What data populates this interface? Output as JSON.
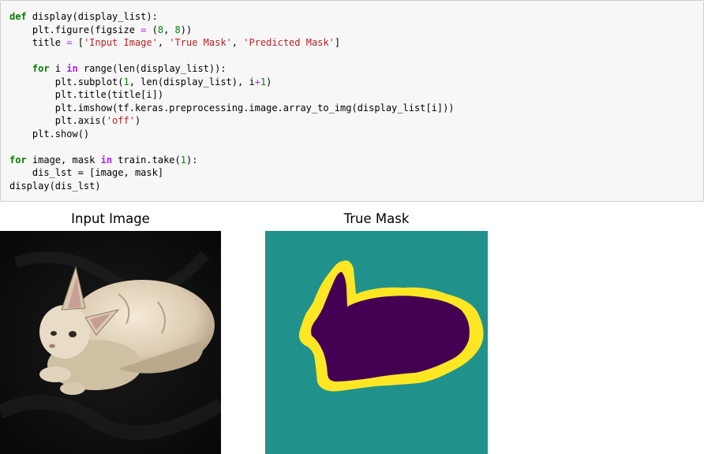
{
  "code_lines": [
    [
      {
        "t": "def",
        "c": "kw"
      },
      {
        "t": " display(display_list):"
      }
    ],
    [
      {
        "t": "    plt.figure(figsize "
      },
      {
        "t": "=",
        "c": "op"
      },
      {
        "t": " ("
      },
      {
        "t": "8",
        "c": "num"
      },
      {
        "t": ", "
      },
      {
        "t": "8",
        "c": "num"
      },
      {
        "t": "))"
      }
    ],
    [
      {
        "t": "    title "
      },
      {
        "t": "=",
        "c": "op"
      },
      {
        "t": " ["
      },
      {
        "t": "'Input Image'",
        "c": "str"
      },
      {
        "t": ", "
      },
      {
        "t": "'True Mask'",
        "c": "str"
      },
      {
        "t": ", "
      },
      {
        "t": "'Predicted Mask'",
        "c": "str"
      },
      {
        "t": "]"
      }
    ],
    [],
    [
      {
        "t": "    "
      },
      {
        "t": "for",
        "c": "kw"
      },
      {
        "t": " i "
      },
      {
        "t": "in",
        "c": "kw2"
      },
      {
        "t": " range(len(display_list)):"
      }
    ],
    [
      {
        "t": "        plt.subplot("
      },
      {
        "t": "1",
        "c": "num"
      },
      {
        "t": ", len(display_list), i"
      },
      {
        "t": "+",
        "c": "op"
      },
      {
        "t": "1",
        "c": "num"
      },
      {
        "t": ")"
      }
    ],
    [
      {
        "t": "        plt.title(title[i])"
      }
    ],
    [
      {
        "t": "        plt.imshow(tf.keras.preprocessing.image.array_to_img(display_list[i]))"
      }
    ],
    [
      {
        "t": "        plt.axis("
      },
      {
        "t": "'off'",
        "c": "str"
      },
      {
        "t": ")"
      }
    ],
    [
      {
        "t": "    plt.show()"
      }
    ],
    [],
    [
      {
        "t": "for",
        "c": "kw"
      },
      {
        "t": " image, mask "
      },
      {
        "t": "in",
        "c": "kw2"
      },
      {
        "t": " train.take("
      },
      {
        "t": "1",
        "c": "num"
      },
      {
        "t": "):"
      }
    ],
    [
      {
        "t": "    dis_lst "
      },
      {
        "t": "="
      },
      {
        "t": " [image, mask]"
      }
    ],
    [
      {
        "t": "display(dis_lst)"
      }
    ]
  ],
  "output": {
    "titles": [
      "Input Image",
      "True Mask"
    ]
  },
  "colors": {
    "mask_background": "#21918c",
    "mask_foreground": "#440154",
    "mask_border": "#fde725"
  }
}
